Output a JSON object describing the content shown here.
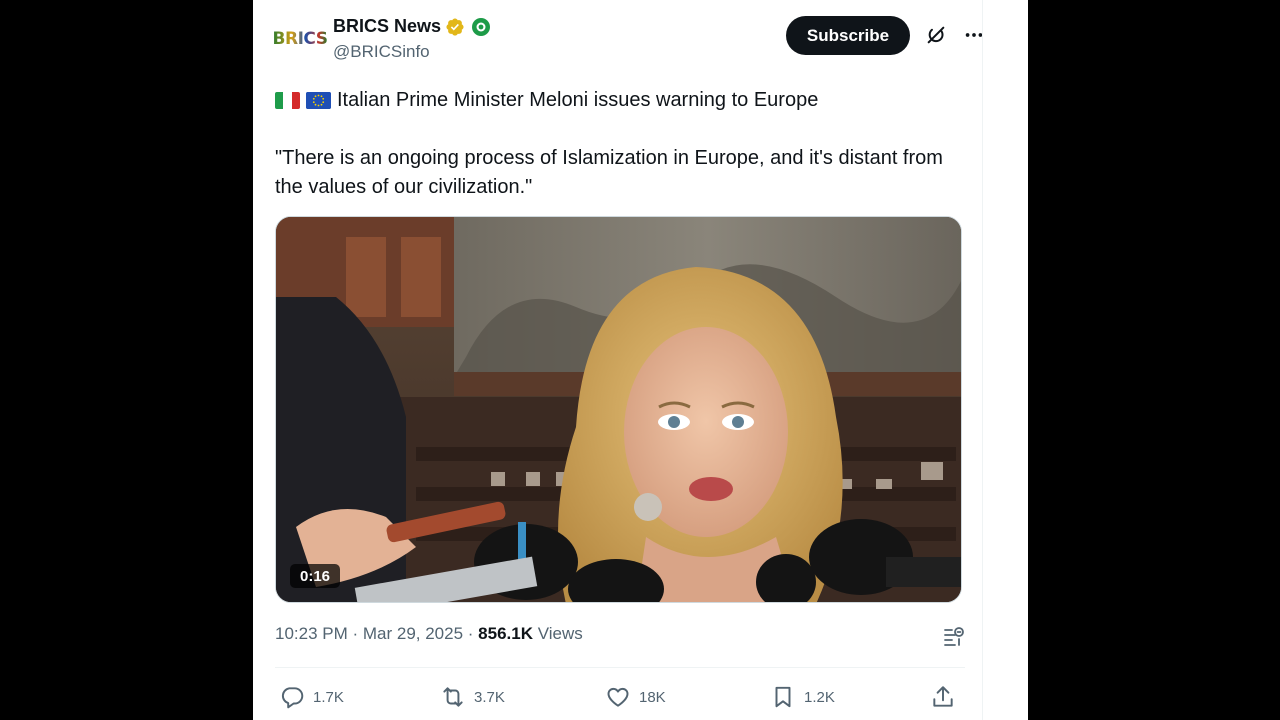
{
  "account": {
    "logo_text": "BRICS",
    "display_name": "BRICS News",
    "handle": "@BRICSinfo"
  },
  "header": {
    "subscribe_label": "Subscribe",
    "grok_icon": "grok-slash-icon",
    "more_icon": "more-horizontal-icon"
  },
  "tweet": {
    "line1": "Italian Prime Minister Meloni issues warning to Europe",
    "flags": [
      "flag-italy",
      "flag-eu"
    ],
    "quote": "\"There is an ongoing process of Islamization in Europe, and it's distant from the values of our civilization.\""
  },
  "media": {
    "duration": "0:16"
  },
  "meta": {
    "time": "10:23 PM",
    "sep1": " · ",
    "date": "Mar 29, 2025",
    "sep2": " · ",
    "views_count": "856.1K",
    "views_label": " Views"
  },
  "actions": {
    "replies": "1.7K",
    "reposts": "3.7K",
    "likes": "18K",
    "bookmarks": "1.2K"
  },
  "colors": {
    "text_primary": "#0f1419",
    "text_secondary": "#536471",
    "verified_gold": "#e2b719",
    "subscribe_bg": "#0f1419"
  }
}
